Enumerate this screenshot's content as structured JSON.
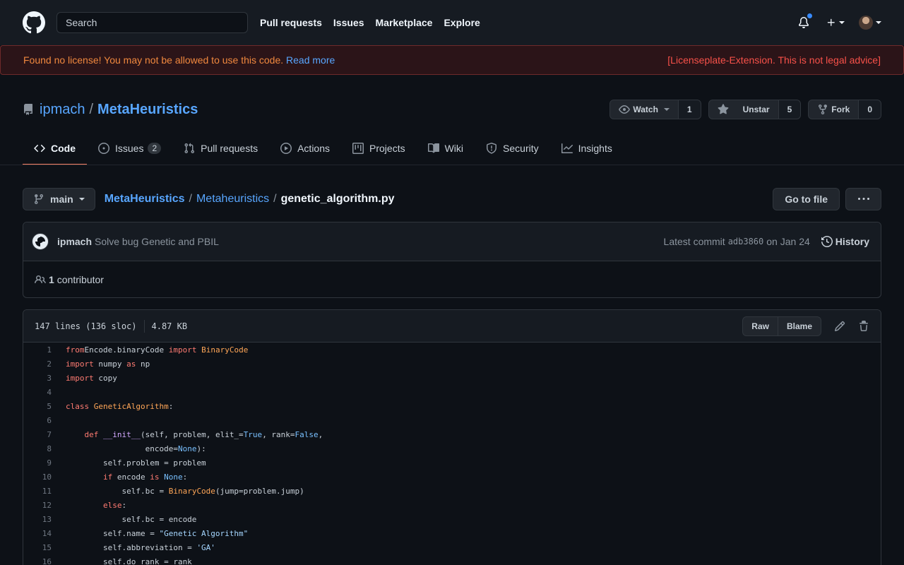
{
  "header": {
    "search_placeholder": "Search",
    "nav": [
      "Pull requests",
      "Issues",
      "Marketplace",
      "Explore"
    ]
  },
  "license_banner": {
    "warning": "Found no license! You may not be allowed to use this code.",
    "link": "Read more",
    "right": "[Licenseplate-Extension. This is not legal advice]"
  },
  "repo": {
    "owner": "ipmach",
    "separator": "/",
    "name": "MetaHeuristics",
    "watch_label": "Watch",
    "watch_count": "1",
    "star_label": "Unstar",
    "star_count": "5",
    "fork_label": "Fork",
    "fork_count": "0"
  },
  "tabs": [
    {
      "label": "Code",
      "icon": "code-icon"
    },
    {
      "label": "Issues",
      "icon": "issue-icon",
      "counter": "2"
    },
    {
      "label": "Pull requests",
      "icon": "pull-request-icon"
    },
    {
      "label": "Actions",
      "icon": "play-icon"
    },
    {
      "label": "Projects",
      "icon": "project-icon"
    },
    {
      "label": "Wiki",
      "icon": "book-icon"
    },
    {
      "label": "Security",
      "icon": "shield-icon"
    },
    {
      "label": "Insights",
      "icon": "graph-icon"
    }
  ],
  "breadcrumb": {
    "branch": "main",
    "path": [
      "MetaHeuristics",
      "Metaheuristics"
    ],
    "file": "genetic_algorithm.py",
    "sep": "/",
    "go_to_file": "Go to file"
  },
  "commit": {
    "author": "ipmach",
    "message": "Solve bug Genetic and PBIL",
    "latest_label": "Latest commit",
    "sha": "adb3860",
    "date": "on Jan 24",
    "history": "History",
    "contributors_count": "1",
    "contributors_label": "contributor"
  },
  "file": {
    "lines": "147 lines (136 sloc)",
    "size": "4.87 KB",
    "raw": "Raw",
    "blame": "Blame",
    "code": [
      {
        "n": "1",
        "tokens": [
          [
            "kw",
            "from"
          ],
          [
            "",
            "Encode.binaryCode "
          ],
          [
            "kw",
            "import"
          ],
          [
            "",
            ""
          ],
          [
            "cls",
            " BinaryCode"
          ]
        ]
      },
      {
        "n": "2",
        "tokens": [
          [
            "kw",
            "import"
          ],
          [
            "",
            " numpy "
          ],
          [
            "kw",
            "as"
          ],
          [
            "",
            " np"
          ]
        ]
      },
      {
        "n": "3",
        "tokens": [
          [
            "kw",
            "import"
          ],
          [
            "",
            " copy"
          ]
        ]
      },
      {
        "n": "4",
        "tokens": []
      },
      {
        "n": "5",
        "tokens": [
          [
            "kw",
            "class"
          ],
          [
            "cls",
            " GeneticAlgorithm"
          ],
          [
            "",
            ":"
          ]
        ]
      },
      {
        "n": "6",
        "tokens": []
      },
      {
        "n": "7",
        "tokens": [
          [
            "",
            "    "
          ],
          [
            "kw",
            "def"
          ],
          [
            "fn",
            " __init__"
          ],
          [
            "",
            "(self, problem, elit_="
          ],
          [
            "cst",
            "True"
          ],
          [
            "",
            ", rank="
          ],
          [
            "cst",
            "False"
          ],
          [
            "",
            ","
          ]
        ]
      },
      {
        "n": "8",
        "tokens": [
          [
            "",
            "                 encode="
          ],
          [
            "cst",
            "None"
          ],
          [
            "",
            "):"
          ]
        ]
      },
      {
        "n": "9",
        "tokens": [
          [
            "",
            "        self.problem = problem"
          ]
        ]
      },
      {
        "n": "10",
        "tokens": [
          [
            "",
            "        "
          ],
          [
            "kw",
            "if"
          ],
          [
            "",
            " encode "
          ],
          [
            "kw",
            "is"
          ],
          [
            "cst",
            " None"
          ],
          [
            "",
            ":"
          ]
        ]
      },
      {
        "n": "11",
        "tokens": [
          [
            "",
            "            self.bc = "
          ],
          [
            "cls",
            "BinaryCode"
          ],
          [
            "",
            "(jump=problem.jump)"
          ]
        ]
      },
      {
        "n": "12",
        "tokens": [
          [
            "",
            "        "
          ],
          [
            "kw",
            "else"
          ],
          [
            "",
            ":"
          ]
        ]
      },
      {
        "n": "13",
        "tokens": [
          [
            "",
            "            self.bc = encode"
          ]
        ]
      },
      {
        "n": "14",
        "tokens": [
          [
            "",
            "        self.name = "
          ],
          [
            "str",
            "\"Genetic Algorithm\""
          ]
        ]
      },
      {
        "n": "15",
        "tokens": [
          [
            "",
            "        self.abbreviation = "
          ],
          [
            "str",
            "'GA'"
          ]
        ]
      },
      {
        "n": "16",
        "tokens": [
          [
            "",
            "        self.do_rank = rank"
          ]
        ]
      }
    ]
  }
}
